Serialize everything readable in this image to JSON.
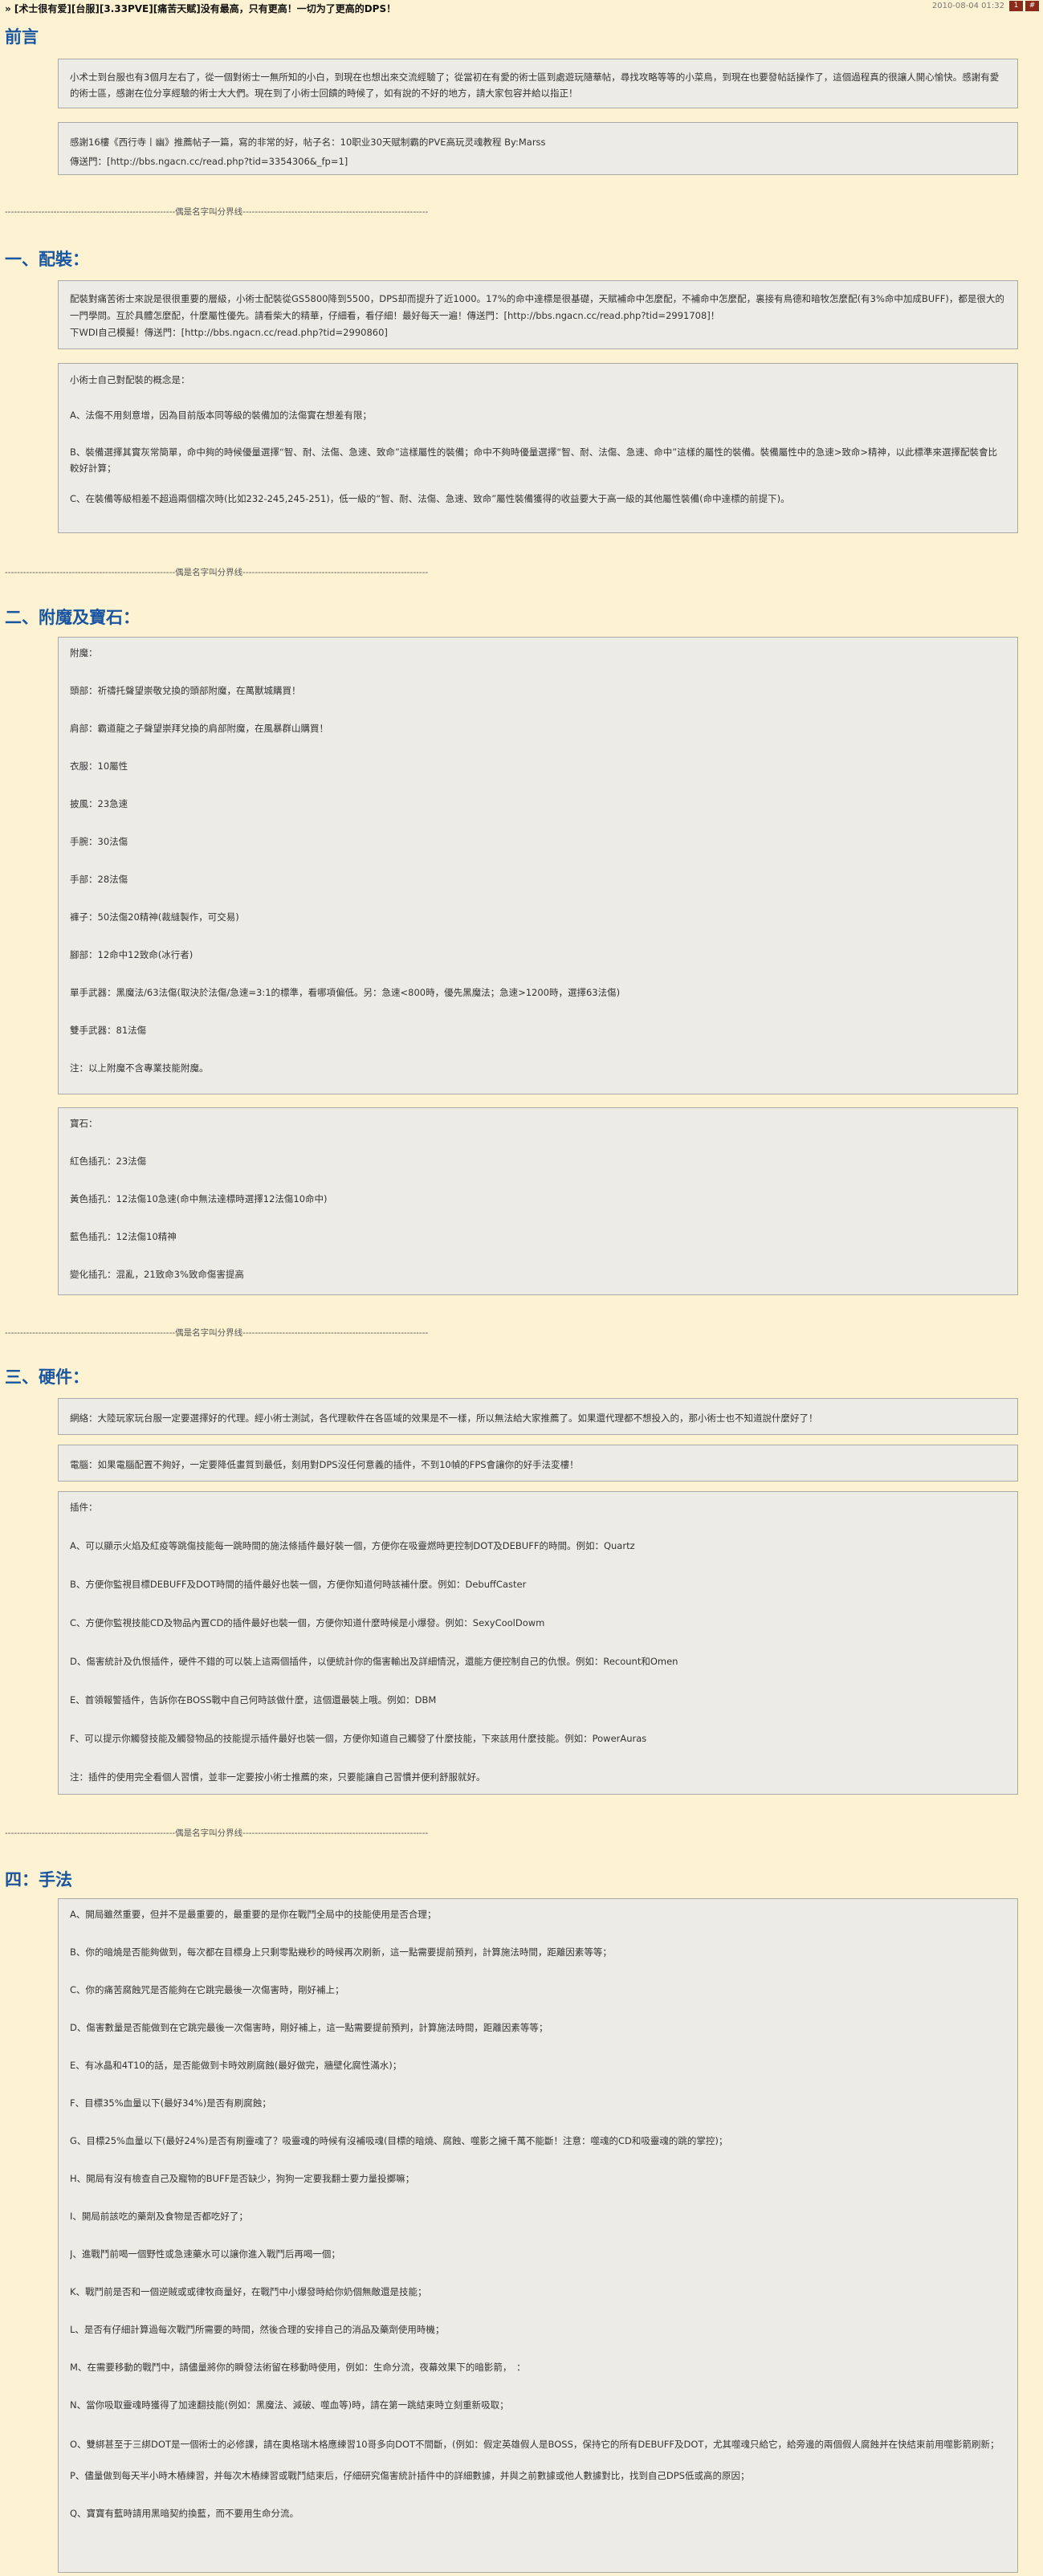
{
  "header": {
    "title": "» [术士很有爱][台服][3.33PVE][痛苦天赋]没有最高，只有更高！一切为了更高的DPS！",
    "date": "2010-08-04 01:32",
    "btn1": "1",
    "btn2": "#"
  },
  "divider_text": "--------------------------------------------------------偶是名字叫分界线-------------------------------------------------------------",
  "sections": {
    "preface": {
      "title": "前言",
      "box1": [
        "小术士到台服也有3個月左右了，從一個對術士一無所知的小白，到現在也想出來交流經驗了；從當初在有愛的術士區到處遊玩隨華帖，尋找攻略等等的小菜鳥，到現在也要發帖話操作了，這個過程真的很讓人開心愉快。感謝有愛的術士區，感謝在位分享經驗的術士大大們。現在到了小術士回饋的時候了，如有說的不好的地方，請大家包容并給以指正！"
      ],
      "box2": [
        "感謝16樓《西行寺丨幽》推薦帖子一篇，寫的非常的好，帖子名：10职业30天赋制霸的PVE高玩灵魂教程 By:Marss",
        "傳送門：[http://bbs.ngacn.cc/read.php?tid=3354306&_fp=1]"
      ]
    },
    "gear": {
      "title": "一、配裝：",
      "box1": [
        "配裝對痛苦術士來說是很很重要的層級，小術士配裝從GS5800降到5500，DPS却而提升了近1000。17%的命中達標是很基礎，天賦補命中怎麼配，不補命中怎麼配，裏接有鳥德和暗牧怎麼配(有3%命中加成BUFF)，都是很大的一門學問。互於具體怎麼配，什麼屬性優先。請看柴大的精華，仔細看，看仔細！最好每天一遍！傳送門：[http://bbs.ngacn.cc/read.php?tid=2991708]！",
        "下WDI自己模擬！傳送門：[http://bbs.ngacn.cc/read.php?tid=2990860]"
      ],
      "box2": [
        "小術士自己對配裝的概念是：",
        "A、法傷不用刻意增，因為目前版本同等級的裝備加的法傷實在想差有限；",
        "B、裝備選擇其實灰常簡單，命中夠的時候優量選擇“智、耐、法傷、急速、致命”這樣屬性的裝備；命中不夠時優量選擇“智、耐、法傷、急速、命中”這樣的屬性的裝備。裝備屬性中的急速>致命>精神，以此標準來選擇配裝會比較好計算；",
        "C、在裝備等級相差不超過兩個檔次時(比如232-245,245-251)，低一級的“智、耐、法傷、急速、致命”屬性裝備獲得的收益要大于高一級的其他屬性裝備(命中達標的前提下)。"
      ]
    },
    "enchant": {
      "title": "二、附魔及寶石：",
      "box1": [
        "附魔：",
        "頭部：祈禱托聲望崇敬兌換的頭部附魔，在萬獸城購買！",
        "肩部：霸道龍之子聲望崇拜兌換的肩部附魔，在風暴群山購買！",
        "衣服：10屬性",
        "披風：23急速",
        "手腕：30法傷",
        "手部：28法傷",
        "褲子：50法傷20精神(裁縫製作，可交易)",
        "腳部：12命中12致命(冰行者)",
        "單手武器：黑魔法/63法傷(取決於法傷/急速=3:1的標準，看哪項偏低。另：急速<800時，優先黑魔法；急速>1200時，選擇63法傷)",
        "雙手武器：81法傷",
        "注：以上附魔不含專業技能附魔。"
      ],
      "box2": [
        "寶石：",
        "紅色插孔：23法傷",
        "黃色插孔：12法傷10急速(命中無法達標時選擇12法傷10命中)",
        "藍色插孔：12法傷10精神",
        "變化插孔：混亂，21致命3%致命傷害提高"
      ]
    },
    "hardware": {
      "title": "三、硬件：",
      "box1": [
        "網絡：大陸玩家玩台服一定要選擇好的代理。經小術士測試，各代理軟件在各區域的效果是不一樣，所以無法給大家推薦了。如果還代理都不想投入的，那小術士也不知道說什麼好了！"
      ],
      "box2": [
        "電腦：如果電腦配置不夠好，一定要降低畫質到最低，刻用對DPS沒任何意義的插件，不到10幀的FPS會讓你的好手法変樓！"
      ],
      "box3": [
        "插件：",
        "A、可以顯示火焰及紅疫等跳傷技能每一跳時間的施法條插件最好裝一個，方便你在吸靈燃時更控制DOT及DEBUFF的時間。例如：Quartz",
        "B、方便你監視目標DEBUFF及DOT時間的插件最好也裝一個，方便你知道何時該補什麼。例如：DebuffCaster",
        "C、方便你監視技能CD及物品內置CD的插件最好也裝一個，方便你知道什麼時候是小爆發。例如：SexyCoolDowm",
        "D、傷害統計及仇恨插件，硬件不錯的可以裝上這兩個插件，以便統計你的傷害輸出及詳細情況，還能方便控制自己的仇恨。例如：Recount和Omen",
        "E、首領報警插件，告訴你在BOSS戰中自己何時該做什麼，這個還最裝上哦。例如：DBM",
        "F、可以提示你觸發技能及觸發物品的技能提示插件最好也裝一個，方便你知道自己觸發了什麼技能，下來該用什麼技能。例如：PowerAuras",
        "注：插件的使用完全看個人習慣，並非一定要按小術士推薦的來，只要能讓自己習慣并便利舒服就好。"
      ]
    },
    "technique": {
      "title": "四：手法",
      "box1": [
        "A、開局雖然重要，但并不是最重要的，最重要的是你在戰鬥全局中的技能使用是否合理；",
        "B、你的暗燒是否能夠做到，每次都在目標身上只剩零點幾秒的時候再次刷新，這一點需要提前預判，計算施法時間，距離因素等等；",
        "C、你的痛苦腐蝕咒是否能夠在它跳完最後一次傷害時，剛好補上；",
        "D、傷害數量是否能做到在它跳完最後一次傷害時，剛好補上，這一點需要提前預判，計算施法時間，距離因素等等；",
        "E、有冰晶和4T10的話，是否能做到卡時效刷腐蝕(最好做完，牆壁化腐性滿水)；",
        "F、目標35%血量以下(最好34%)是否有刷腐蝕；",
        "G、目標25%血量以下(最好24%)是否有刷靈魂了？吸靈魂的時候有沒補吸魂(目標的暗燒、腐蝕、噬影之擁千萬不能斷！注意：噬魂的CD和吸靈魂的跳的掌控)；",
        "H、開局有沒有檢查自己及寵物的BUFF是否缺少，狗狗一定要我翻士要力量投擲嘛；",
        "I、開局前該吃的藥劑及食物是否都吃好了；",
        "J、進戰鬥前喝一個野性或急速藥水可以讓你進入戰鬥后再喝一個；",
        "K、戰鬥前是否和一個逆賊或或律牧商量好，在戰鬥中小爆發時給你奶個無敵還是技能；",
        "L、是否有仔細計算過每次戰鬥所需要的時間，然後合理的安排自己的消品及藥劑使用時機；",
        "M、在需要移動的戰鬥中，請儘量將你的瞬發法術留在移動時使用，例如：生命分流，夜幕效果下的暗影箭，　：",
        "N、當你吸取靈魂時獲得了加速翻技能(例如：黑魔法、減破、噬血等)時，請在第一跳結束時立刻重新吸取；",
        "O、雙綁甚至于三綁DOT是一個術士的必修課，請在奧格瑞木格應練習10哥多向DOT不間斷，(例如：假定英雄假人是BOSS，保持它的所有DEBUFF及DOT，尤其噬魂只給它，給旁邊的兩個假人腐蝕并在快結束前用噬影箭刷新；",
        "P、儘量做到每天半小時木樁練習，并每次木樁練習或戰鬥結束后，仔細研究傷害統計插件中的詳細數據，并與之前數據或他人數據對比，找到自己DPS低或高的原因；",
        "Q、寶寶有藍時請用黑暗契約換藍，而不要用生命分流。"
      ]
    }
  }
}
